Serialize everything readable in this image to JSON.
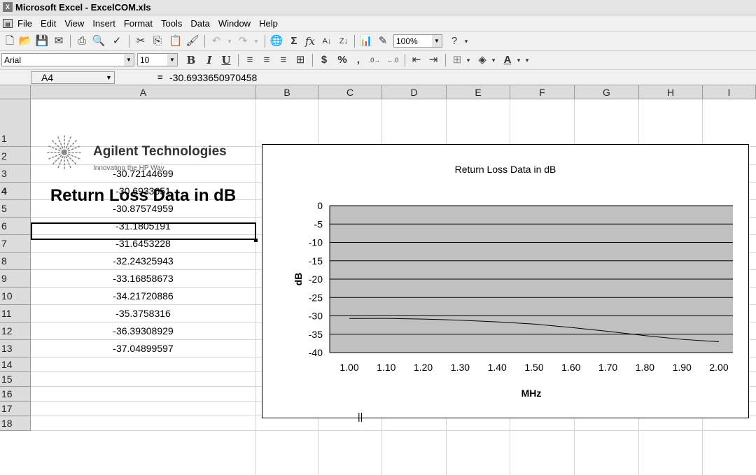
{
  "window": {
    "title": "Microsoft Excel - ExcelCOM.xls",
    "app_icon": "excel-icon"
  },
  "menu": [
    "File",
    "Edit",
    "View",
    "Insert",
    "Format",
    "Tools",
    "Data",
    "Window",
    "Help"
  ],
  "toolbar": {
    "zoom": "100%",
    "font": "Arial",
    "font_size": "10",
    "currency": "$",
    "percent": "%",
    "comma": ","
  },
  "formula_bar": {
    "cell_ref": "A4",
    "equals": "=",
    "formula": "-30.6933650970458"
  },
  "columns": [
    "A",
    "B",
    "C",
    "D",
    "E",
    "F",
    "G",
    "H",
    "I"
  ],
  "rows": [
    "1",
    "2",
    "3",
    "4",
    "5",
    "6",
    "7",
    "8",
    "9",
    "10",
    "11",
    "12",
    "13",
    "14",
    "15",
    "16",
    "17",
    "18"
  ],
  "logo": {
    "name": "Agilent Technologies",
    "tagline": "Innovating the HP Way"
  },
  "header_a2": "Return Loss Data in dB",
  "data_cells": [
    "-30.72144699",
    "-30.6933651",
    "-30.87574959",
    "-31.1805191",
    "-31.6453228",
    "-32.24325943",
    "-33.16858673",
    "-34.21720886",
    "-35.3758316",
    "-36.39308929",
    "-37.04899597"
  ],
  "selected_cell": "A4",
  "chart_data": {
    "type": "line",
    "title": "Return Loss Data in dB",
    "xlabel": "MHz",
    "ylabel": "dB",
    "x": [
      "1.00",
      "1.10",
      "1.20",
      "1.30",
      "1.40",
      "1.50",
      "1.60",
      "1.70",
      "1.80",
      "1.90",
      "2.00"
    ],
    "yticks": [
      "0",
      "-5",
      "-10",
      "-15",
      "-20",
      "-25",
      "-30",
      "-35",
      "-40"
    ],
    "ylim": [
      -40,
      0
    ],
    "grid": true,
    "legend": "none",
    "plot_color": "#c0c0c0",
    "series": [
      {
        "values": [
          -30.72144699,
          -30.6933651,
          -30.87574959,
          -31.1805191,
          -31.6453228,
          -32.24325943,
          -33.16858673,
          -34.21720886,
          -35.3758316,
          -36.39308929,
          -37.04899597
        ]
      }
    ]
  }
}
